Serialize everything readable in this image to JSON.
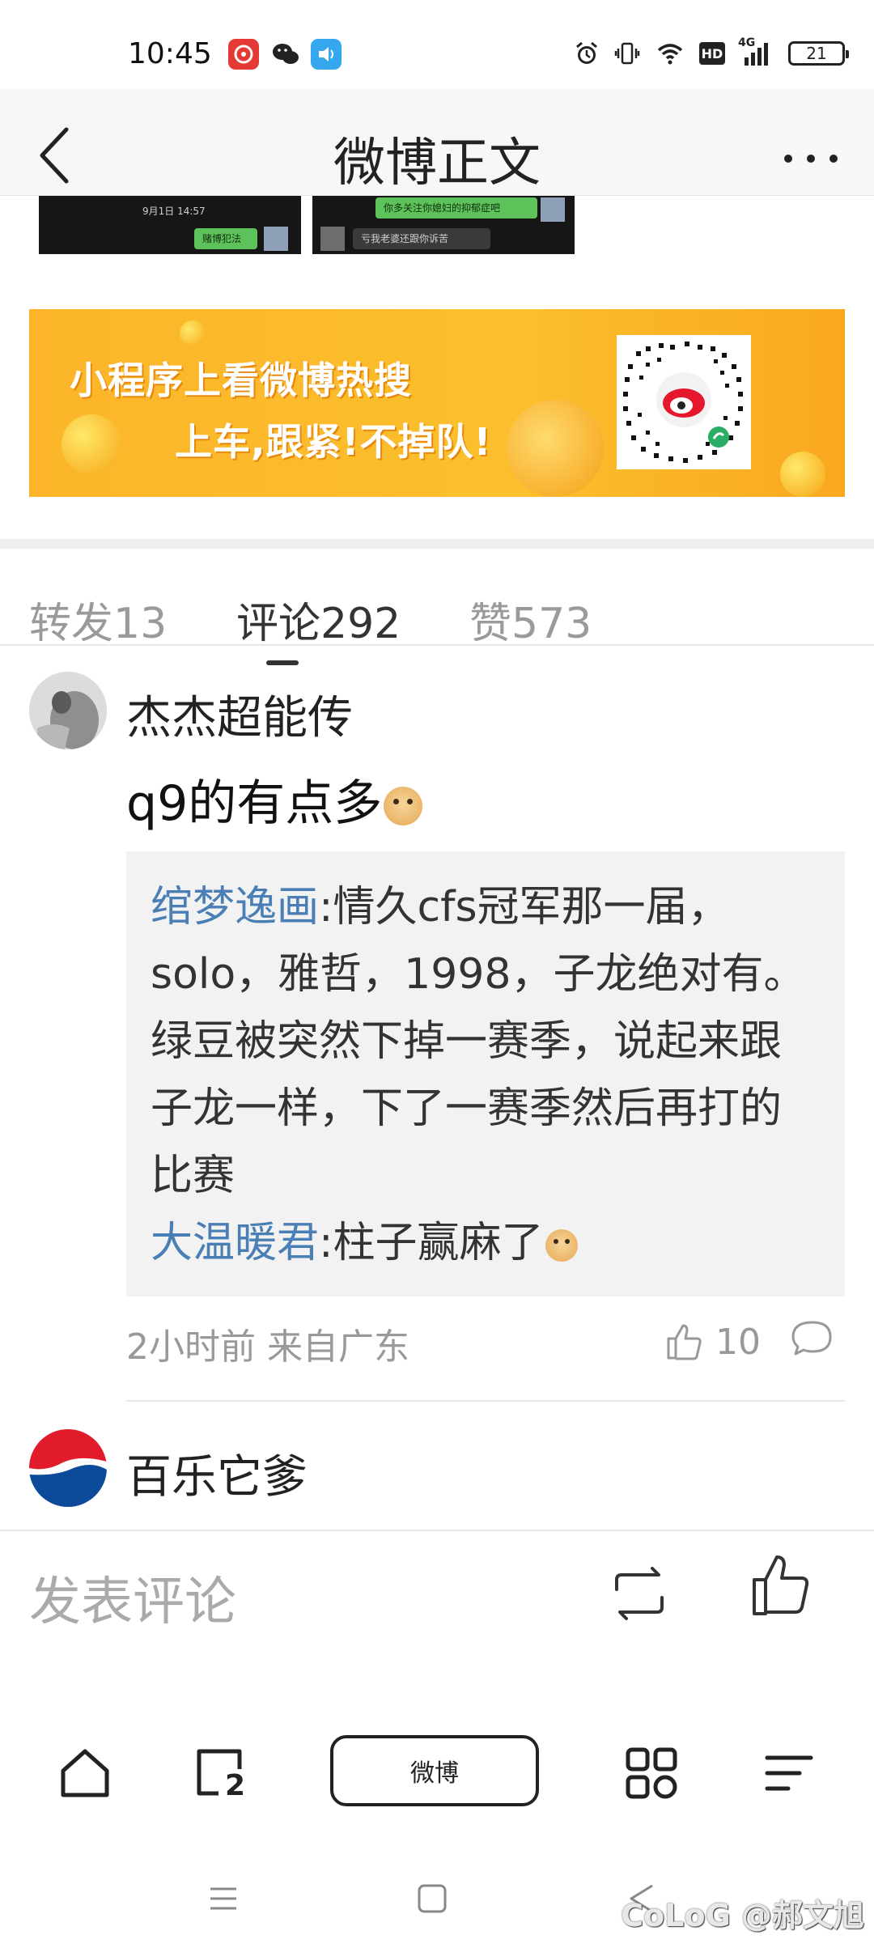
{
  "status_bar": {
    "time": "10:45",
    "battery": "21",
    "network": "4G",
    "hd": "HD",
    "app_icons": [
      "netease-music-icon",
      "wechat-icon",
      "message-icon"
    ],
    "right_icons": [
      "alarm-icon",
      "vibrate-icon",
      "wifi-icon",
      "hd-icon",
      "signal-icon",
      "battery-icon"
    ]
  },
  "header": {
    "title": "微博正文"
  },
  "top_images": {
    "image1": {
      "timestamp": "9月1日 14:57",
      "bubble": "赌博犯法"
    },
    "image2": {
      "bubble1": "你多关注你媳妇的抑郁症吧",
      "bubble2": "亏我老婆还跟你诉苦"
    }
  },
  "banner": {
    "line1": "小程序上看微博热搜",
    "line2": "上车,跟紧!不掉队!",
    "colors": {
      "bg": "#fbb52a",
      "text": "#ffffff"
    }
  },
  "tabs": [
    {
      "label": "转发13",
      "active": false
    },
    {
      "label": "评论292",
      "active": true
    },
    {
      "label": "赞573",
      "active": false
    }
  ],
  "comments": [
    {
      "user": "杰杰超能传",
      "text": "q9的有点多",
      "replies": [
        {
          "name": "绾梦逸画",
          "sep": ":",
          "text": "情久cfs冠军那一届，solo，雅哲，1998，子龙绝对有。绿豆被突然下掉一赛季，说起来跟子龙一样，下了一赛季然后再打的比赛"
        },
        {
          "name": "大温暖君",
          "sep": ":",
          "text": "柱子赢麻了"
        }
      ],
      "meta": "2小时前 来自广东",
      "likes": "10"
    },
    {
      "user": "百乐它爹"
    }
  ],
  "compose": {
    "placeholder": "发表评论"
  },
  "bottom_nav": {
    "center_label": "微博",
    "items": [
      "home-icon",
      "tabs-icon",
      "weibo-button",
      "apps-icon",
      "menu-icon"
    ],
    "tab_count": "2"
  },
  "watermark": "CoLoG @郝文旭",
  "colors": {
    "link": "#4a7fb5",
    "muted": "#999999",
    "reply_bg": "#f2f2f2"
  }
}
